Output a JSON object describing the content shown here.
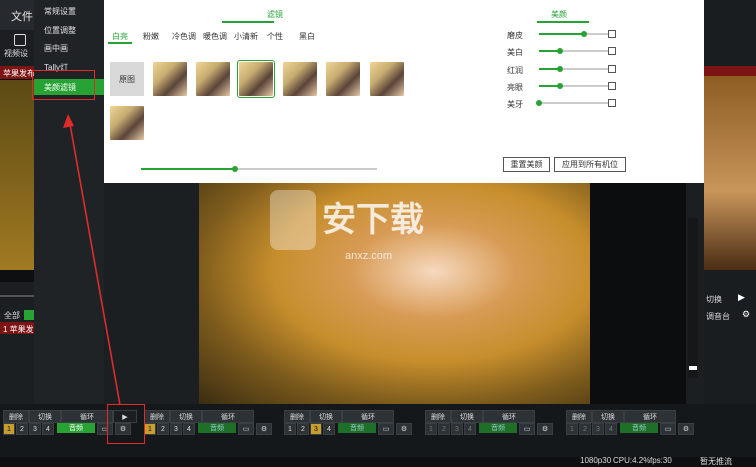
{
  "app": {
    "menu_file": "文件",
    "toolbar_label": "视频设",
    "source_red": "苹果发布"
  },
  "settings_menu": {
    "items": [
      "常规设置",
      "位置调整",
      "画中画",
      "Tally灯",
      "美颜滤镜"
    ],
    "active_index": 4
  },
  "filters": {
    "tab_title": "滤镜",
    "categories": [
      "白亮",
      "粉嫩",
      "冷色调",
      "暖色调",
      "小清新",
      "个性",
      "黑白"
    ],
    "active_category": 0,
    "original_label": "原图",
    "intensity": 0.4
  },
  "beauty": {
    "tab_title": "美颜",
    "sliders": [
      {
        "label": "磨皮",
        "value": 0.65
      },
      {
        "label": "美白",
        "value": 0.3
      },
      {
        "label": "红润",
        "value": 0.3
      },
      {
        "label": "亮眼",
        "value": 0.3
      },
      {
        "label": "美牙",
        "value": 0.0
      }
    ],
    "reset_button": "重置美颜",
    "apply_all_button": "应用到所有机位"
  },
  "watermark": {
    "main": "安下载",
    "sub": "anxz.com"
  },
  "left_lower": {
    "all_label": "全部",
    "row_label": "1 苹果发"
  },
  "right_side": {
    "cut_label": "切换",
    "audio_label": "调音台"
  },
  "channel_controls": {
    "delete": "删除",
    "cut": "切换",
    "loop": "循环",
    "audio": "音频",
    "numbers": [
      "1",
      "2",
      "3",
      "4"
    ]
  },
  "status": {
    "resolution": "1080p30",
    "cpu": "CPU:4.2%",
    "fps": "fps:30",
    "stream": "暂无推流"
  }
}
